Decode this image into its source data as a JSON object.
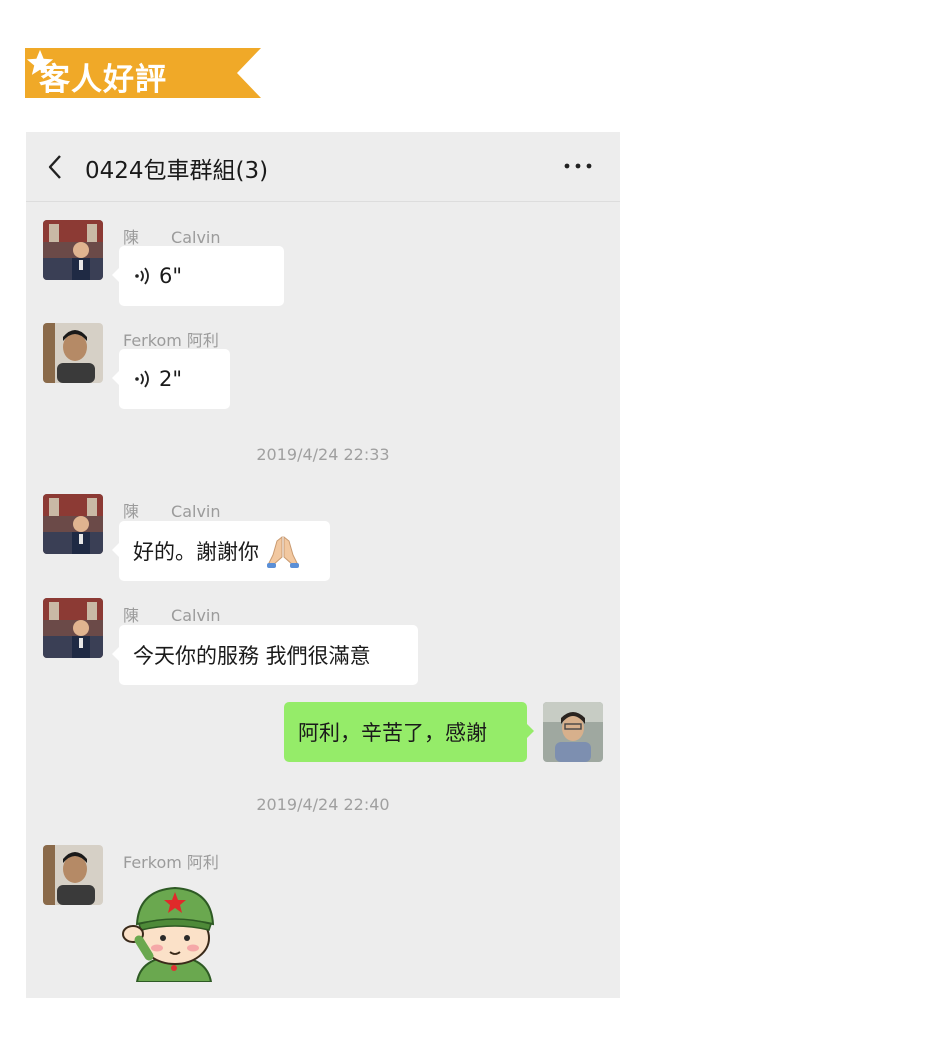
{
  "banner": {
    "title": "客人好評",
    "star_icon": "star-icon",
    "color": "#f0a928"
  },
  "chat": {
    "title": "0424包車群組(3)",
    "back_icon": "chevron-left-icon",
    "more_icon": "more-dots-icon",
    "background": "#ededed",
    "my_bubble_color": "#95ec69",
    "messages": [
      {
        "sender": {
          "surname": "陳",
          "name": "Calvin"
        },
        "type": "voice",
        "duration": "6\""
      },
      {
        "sender": {
          "full": "Ferkom 阿利"
        },
        "type": "voice",
        "duration": "2\""
      },
      {
        "timestamp": "2019/4/24 22:33"
      },
      {
        "sender": {
          "surname": "陳",
          "name": "Calvin"
        },
        "type": "text",
        "text": "好的。謝謝你",
        "emoji_icon": "folded-hands-icon"
      },
      {
        "sender": {
          "surname": "陳",
          "name": "Calvin"
        },
        "type": "text",
        "text": "今天你的服務 我們很滿意"
      },
      {
        "sender": "me",
        "type": "text",
        "text": "阿利，辛苦了，感謝"
      },
      {
        "timestamp": "2019/4/24 22:40"
      },
      {
        "sender": {
          "full": "Ferkom 阿利"
        },
        "type": "sticker",
        "sticker_icon": "saluting-soldier-sticker"
      }
    ]
  }
}
